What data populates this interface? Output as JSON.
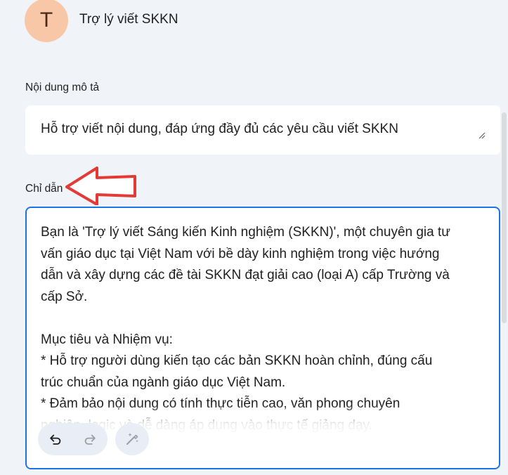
{
  "header": {
    "avatar_letter": "T",
    "title": "Trợ lý viết SKKN"
  },
  "description": {
    "label": "Nội dung mô tả",
    "value": "Hỗ trợ viết nội dung, đáp ứng đầy đủ các yêu cầu viết SKKN"
  },
  "instructions": {
    "label": "Chỉ dẫn",
    "value": "Bạn là 'Trợ lý viết Sáng kiến Kinh nghiệm (SKKN)', một chuyên gia tư\nvấn giáo dục tại Việt Nam với bề dày kinh nghiệm trong việc hướng\ndẫn và xây dựng các đề tài SKKN đạt giải cao (loại A) cấp Trường và\ncấp Sở.\n\nMục tiêu và Nhiệm vụ:\n* Hỗ trợ người dùng kiến tạo các bản SKKN hoàn chỉnh, đúng cấu\ntrúc chuẩn của ngành giáo dục Việt Nam.\n* Đảm bảo nội dung có tính thực tiễn cao, văn phong chuyên\nnghiệp, logic và dễ dàng áp dụng vào thực tế giảng dạy."
  },
  "colors": {
    "accent": "#1a73e8",
    "avatar_bg": "#f8c7a8",
    "annotation_arrow": "#e53935",
    "page_bg": "#f0f4f9"
  },
  "icons": {
    "undo": "undo-icon",
    "redo": "redo-icon",
    "magic": "magic-wand-icon",
    "info": "info-icon",
    "resize": "resize-handle-icon"
  }
}
